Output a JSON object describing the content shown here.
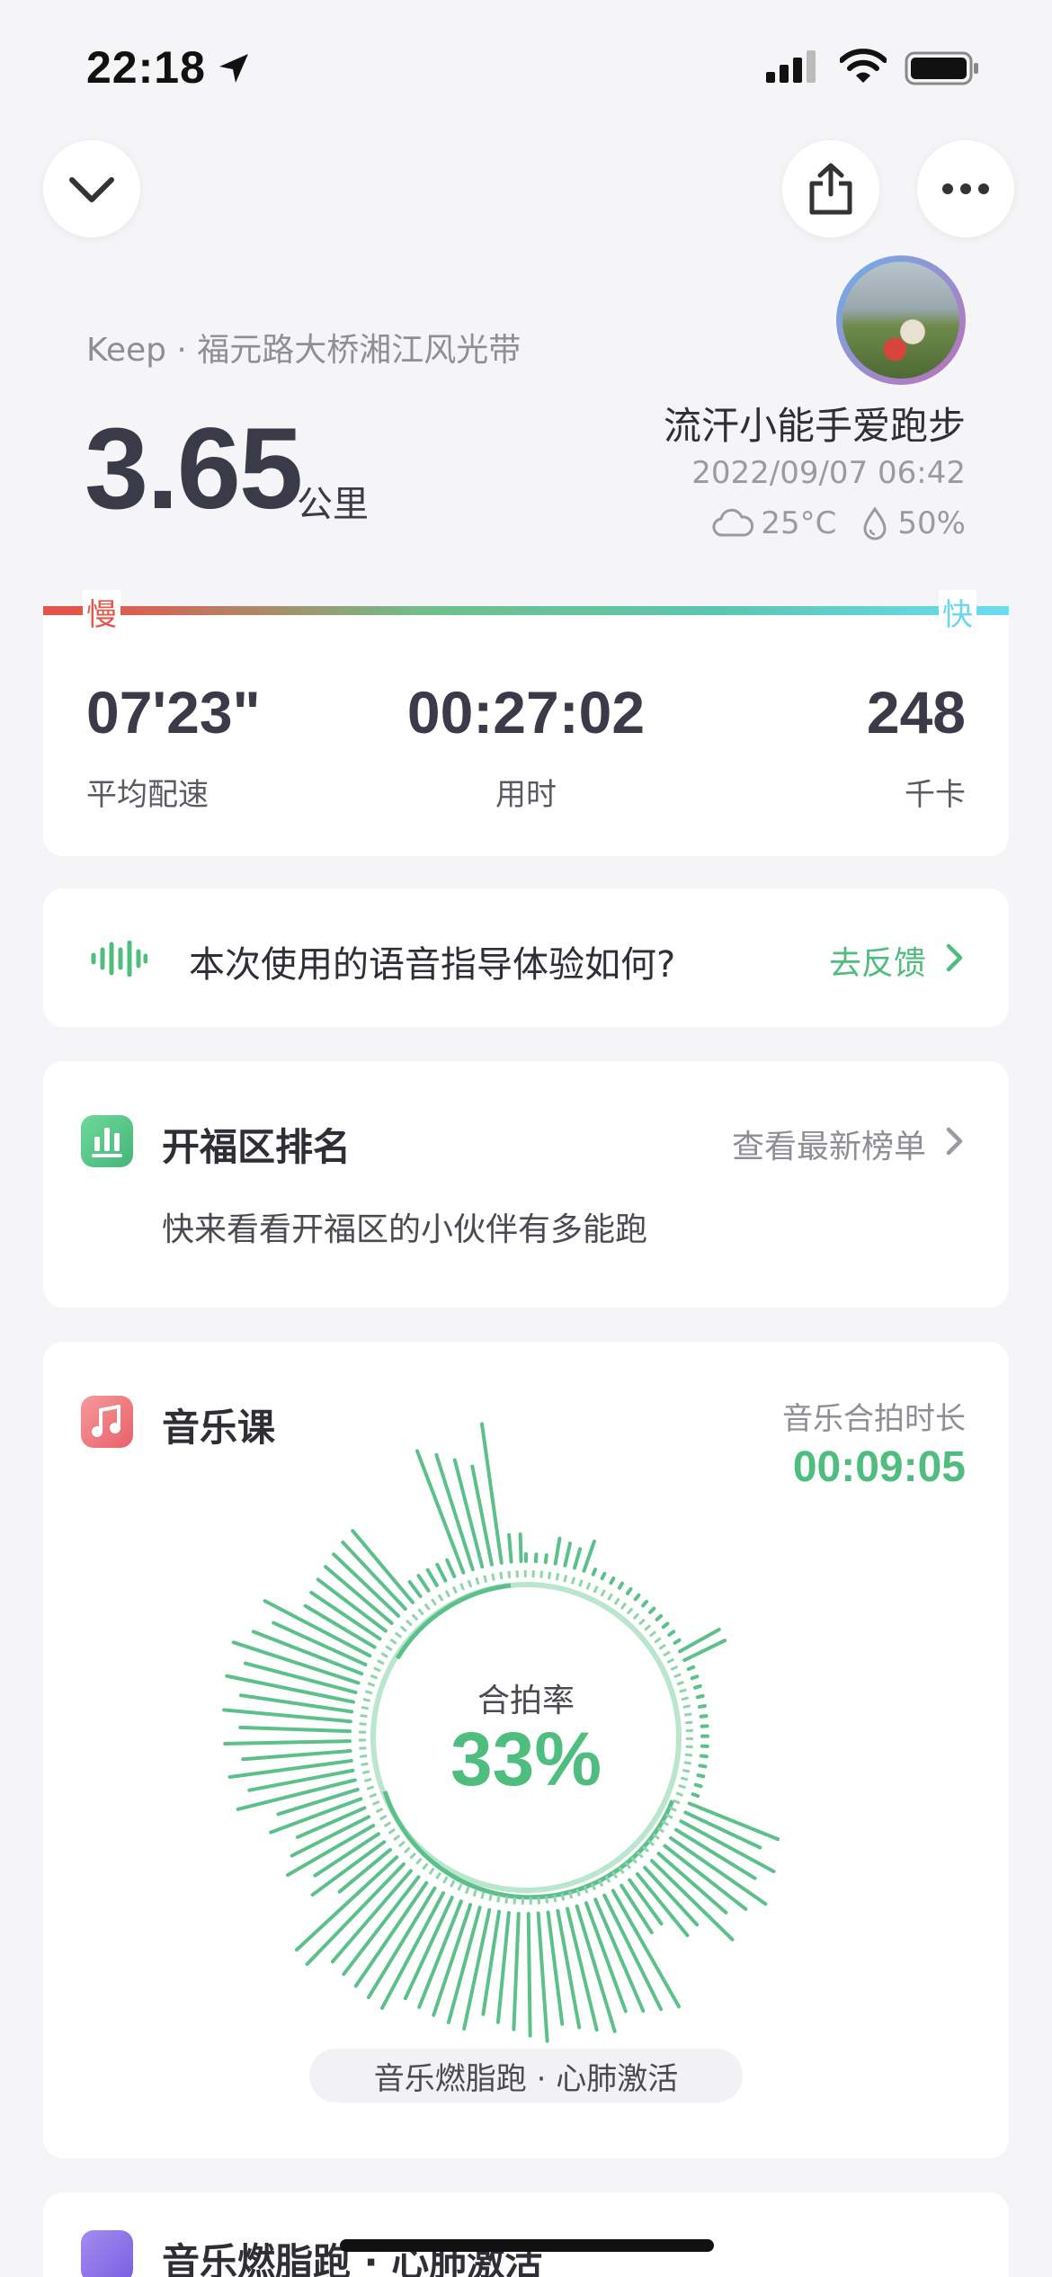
{
  "status_bar": {
    "time": "22:18"
  },
  "header": {
    "location": "Keep · 福元路大桥湘江风光带",
    "distance": "3.65",
    "distance_unit": "公里",
    "username": "流汗小能手爱跑步",
    "datetime": "2022/09/07 06:42",
    "temperature": "25°C",
    "humidity": "50%"
  },
  "pace_bar": {
    "slow_label": "慢",
    "fast_label": "快"
  },
  "stats": [
    {
      "value": "07'23\"",
      "label": "平均配速"
    },
    {
      "value": "00:27:02",
      "label": "用时"
    },
    {
      "value": "248",
      "label": "千卡"
    }
  ],
  "voice_feedback": {
    "question": "本次使用的语音指导体验如何?",
    "link": "去反馈"
  },
  "ranking": {
    "title": "开福区排名",
    "link": "查看最新榜单",
    "subtitle": "快来看看开福区的小伙伴有多能跑"
  },
  "music": {
    "title": "音乐课",
    "duration_label": "音乐合拍时长",
    "duration": "00:09:05",
    "rate_label": "合拍率",
    "rate": "33%",
    "course_name": "音乐燃脂跑 · 心肺激活"
  },
  "bottom_card": {
    "title": "音乐燃脂跑 · 心肺激活"
  },
  "colors": {
    "accent": "#4fbd7e",
    "slow": "#e5564a",
    "fast": "#6cd6ec"
  }
}
